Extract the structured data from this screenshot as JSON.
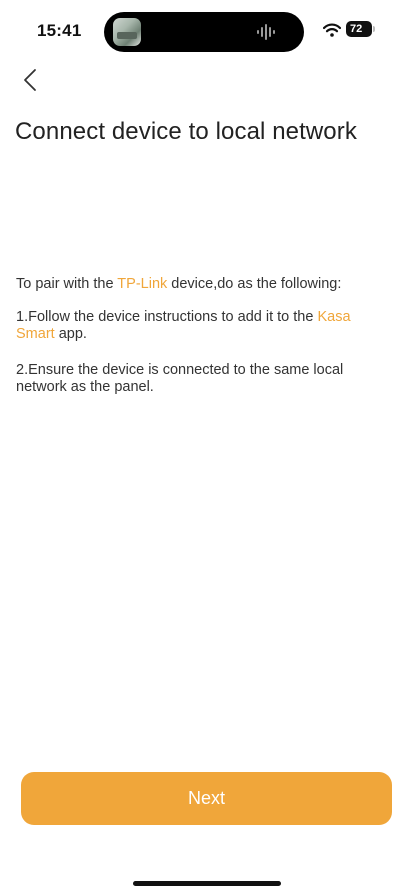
{
  "status_bar": {
    "time": "15:41",
    "battery_level": "72"
  },
  "header": {
    "title": "Connect device to local network"
  },
  "content": {
    "intro_prefix": "To pair with the ",
    "intro_brand": "TP-Link",
    "intro_suffix": " device,do as the following:",
    "step1_prefix": "1.Follow the device instructions to add it to the ",
    "step1_app": "Kasa Smart",
    "step1_suffix": " app.",
    "step2": "2.Ensure the device is connected to the same local network as the panel."
  },
  "footer": {
    "next_label": "Next"
  },
  "colors": {
    "accent": "#f0a63a",
    "button": "#f0a63a",
    "text": "#222222"
  }
}
